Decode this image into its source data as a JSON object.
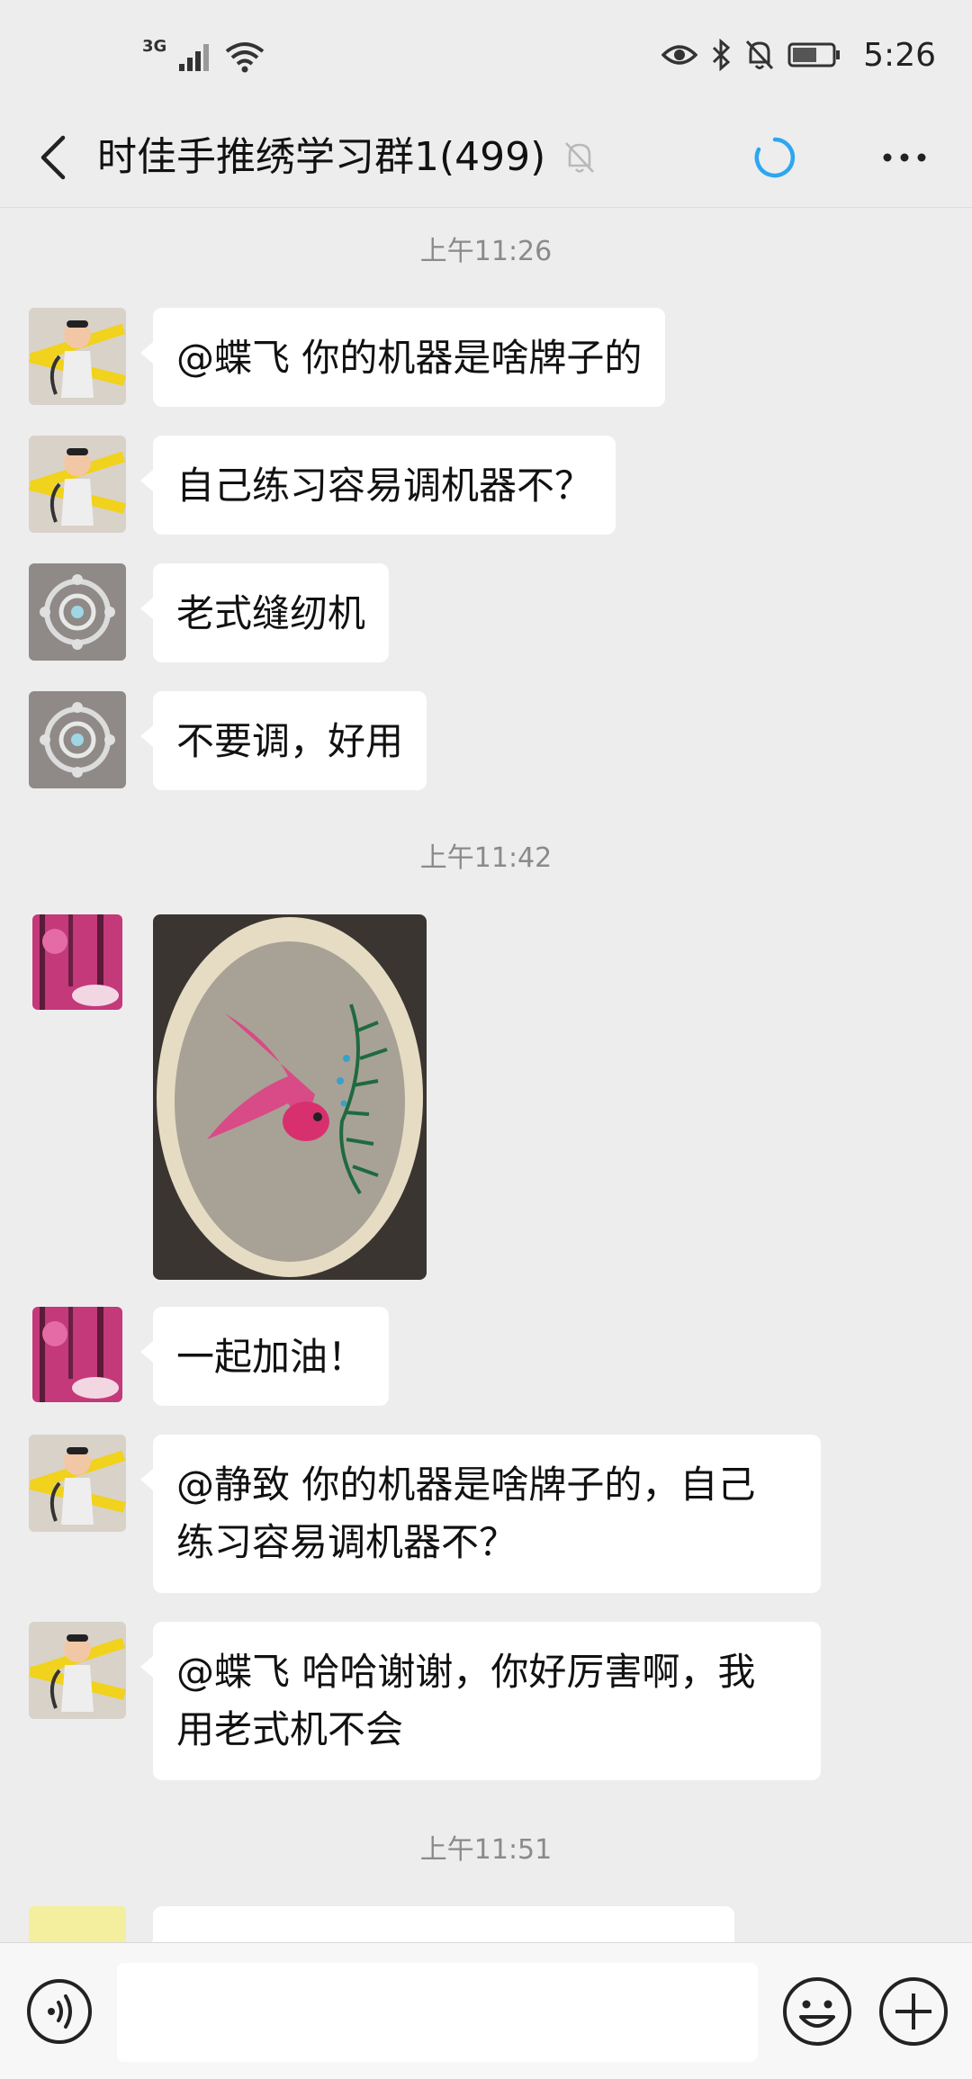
{
  "status_bar": {
    "network": "3G",
    "time": "5:26"
  },
  "header": {
    "title": "时佳手推绣学习群1(499)",
    "icons": [
      "back-arrow-icon",
      "mute-bell-icon",
      "loading-spinner-icon",
      "more-icon"
    ]
  },
  "messages": [
    {
      "type": "timestamp",
      "text": "上午11:26"
    },
    {
      "type": "text",
      "avatar": "avatar-girl",
      "lines": [
        "@蝶飞  你的机器是啥牌子的"
      ]
    },
    {
      "type": "text",
      "avatar": "avatar-girl",
      "lines": [
        "自己练习容易调机器不？"
      ]
    },
    {
      "type": "text",
      "avatar": "avatar-embroidery",
      "lines": [
        "老式缝纫机"
      ]
    },
    {
      "type": "text",
      "avatar": "avatar-embroidery",
      "lines": [
        "不要调，好用"
      ]
    },
    {
      "type": "timestamp",
      "text": "上午11:42"
    },
    {
      "type": "image",
      "avatar": "avatar-pink-forest",
      "image": "goldfish-embroidery-hoop"
    },
    {
      "type": "text",
      "avatar": "avatar-pink-forest",
      "lines": [
        "一起加油！"
      ]
    },
    {
      "type": "text",
      "avatar": "avatar-girl",
      "lines": [
        "@静致  你的机器是啥牌子的，自己",
        "练习容易调机器不？"
      ]
    },
    {
      "type": "text",
      "avatar": "avatar-girl",
      "lines": [
        "@蝶飞  哈哈谢谢，你好厉害啊，我",
        "用老式机不会"
      ]
    },
    {
      "type": "timestamp",
      "text": "上午11:51"
    }
  ],
  "input_bar": {
    "value": "",
    "icons": [
      "voice-icon",
      "emoji-icon",
      "plus-icon"
    ]
  },
  "colors": {
    "background": "#ededed",
    "bubble": "#ffffff",
    "timestamp": "#8a8a8a",
    "spinner": "#2ea6f0"
  }
}
